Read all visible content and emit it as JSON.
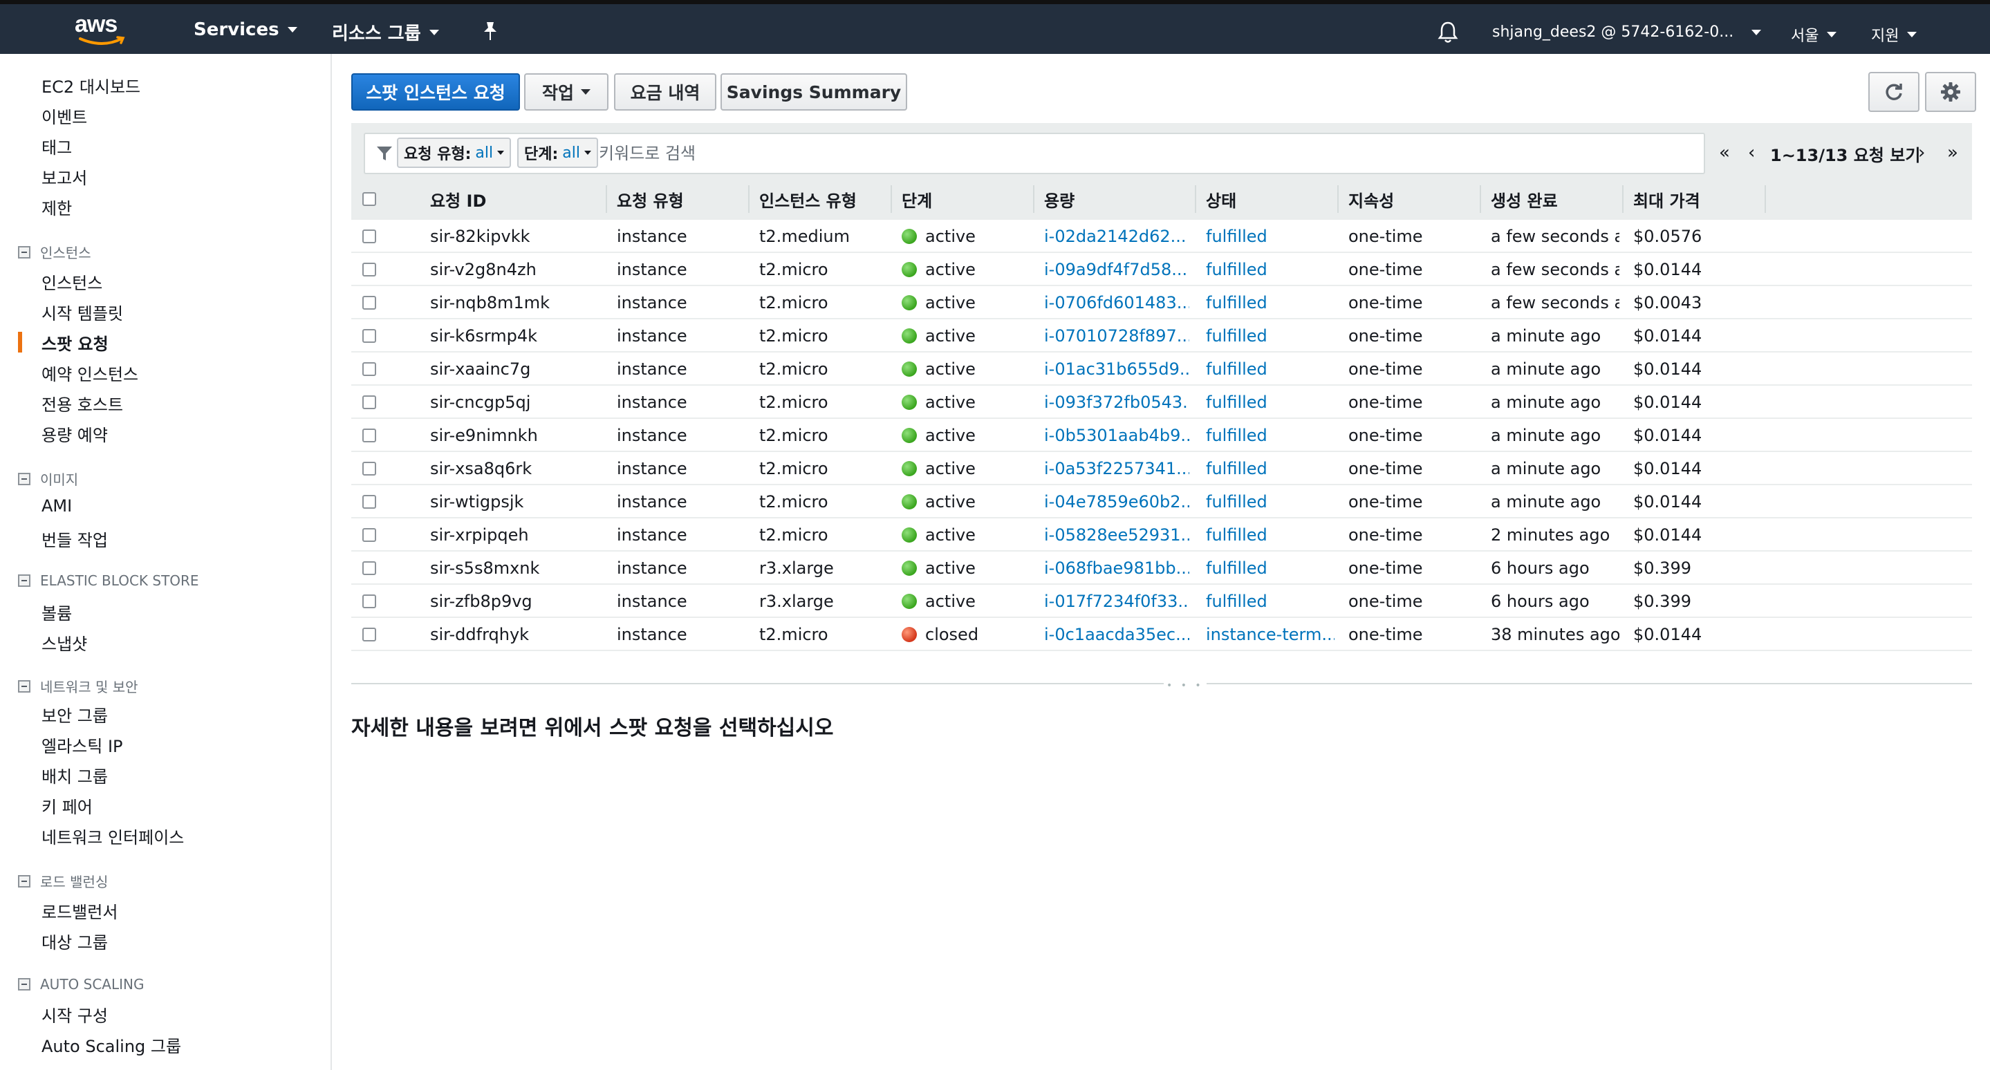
{
  "topnav": {
    "logo_text": "aws",
    "services_label": "Services",
    "resource_groups_label": "리소스 그룹",
    "account_label": "shjang_dees2 @ 5742-6162-0...",
    "region_label": "서울",
    "support_label": "지원"
  },
  "sidebar": {
    "top_items": [
      "EC2 대시보드",
      "이벤트",
      "태그",
      "보고서",
      "제한"
    ],
    "sections": [
      {
        "title": "인스턴스",
        "items": [
          "인스턴스",
          "시작 템플릿",
          "스팟 요청",
          "예약 인스턴스",
          "전용 호스트",
          "용량 예약"
        ]
      },
      {
        "title": "이미지",
        "items": [
          "AMI",
          "번들 작업"
        ]
      },
      {
        "title": "ELASTIC BLOCK STORE",
        "items": [
          "볼륨",
          "스냅샷"
        ]
      },
      {
        "title": "네트워크 및 보안",
        "items": [
          "보안 그룹",
          "엘라스틱 IP",
          "배치 그룹",
          "키 페어",
          "네트워크 인터페이스"
        ]
      },
      {
        "title": "로드 밸런싱",
        "items": [
          "로드밸런서",
          "대상 그룹"
        ]
      },
      {
        "title": "AUTO SCALING",
        "items": [
          "시작 구성",
          "Auto Scaling 그룹"
        ]
      }
    ],
    "active_item": "스팟 요청"
  },
  "toolbar": {
    "request_spot_label": "스팟 인스턴스 요청",
    "actions_label": "작업",
    "pricing_history_label": "요금 내역",
    "savings_summary_label": "Savings Summary"
  },
  "filter": {
    "request_type_label": "요청 유형:",
    "request_type_value": "all",
    "state_label": "단계:",
    "state_value": "all",
    "search_placeholder": "키워드로 검색",
    "pagination_text": "1~13/13 요청 보기"
  },
  "table": {
    "columns": [
      "요청 ID",
      "요청 유형",
      "인스턴스 유형",
      "단계",
      "용량",
      "상태",
      "지속성",
      "생성 완료",
      "최대 가격"
    ],
    "rows": [
      {
        "id": "sir-82kipvkk",
        "type": "instance",
        "instance_type": "t2.medium",
        "state": "active",
        "state_color": "green",
        "capacity": "i-02da2142d62...",
        "status": "fulfilled",
        "persistence": "one-time",
        "created": "a few seconds a...",
        "max_price": "$0.0576"
      },
      {
        "id": "sir-v2g8n4zh",
        "type": "instance",
        "instance_type": "t2.micro",
        "state": "active",
        "state_color": "green",
        "capacity": "i-09a9df4f7d58...",
        "status": "fulfilled",
        "persistence": "one-time",
        "created": "a few seconds a...",
        "max_price": "$0.0144"
      },
      {
        "id": "sir-nqb8m1mk",
        "type": "instance",
        "instance_type": "t2.micro",
        "state": "active",
        "state_color": "green",
        "capacity": "i-0706fd601483...",
        "status": "fulfilled",
        "persistence": "one-time",
        "created": "a few seconds a...",
        "max_price": "$0.0043"
      },
      {
        "id": "sir-k6srmp4k",
        "type": "instance",
        "instance_type": "t2.micro",
        "state": "active",
        "state_color": "green",
        "capacity": "i-07010728f897...",
        "status": "fulfilled",
        "persistence": "one-time",
        "created": "a minute ago",
        "max_price": "$0.0144"
      },
      {
        "id": "sir-xaainc7g",
        "type": "instance",
        "instance_type": "t2.micro",
        "state": "active",
        "state_color": "green",
        "capacity": "i-01ac31b655d9...",
        "status": "fulfilled",
        "persistence": "one-time",
        "created": "a minute ago",
        "max_price": "$0.0144"
      },
      {
        "id": "sir-cncgp5qj",
        "type": "instance",
        "instance_type": "t2.micro",
        "state": "active",
        "state_color": "green",
        "capacity": "i-093f372fb0543...",
        "status": "fulfilled",
        "persistence": "one-time",
        "created": "a minute ago",
        "max_price": "$0.0144"
      },
      {
        "id": "sir-e9nimnkh",
        "type": "instance",
        "instance_type": "t2.micro",
        "state": "active",
        "state_color": "green",
        "capacity": "i-0b5301aab4b9...",
        "status": "fulfilled",
        "persistence": "one-time",
        "created": "a minute ago",
        "max_price": "$0.0144"
      },
      {
        "id": "sir-xsa8q6rk",
        "type": "instance",
        "instance_type": "t2.micro",
        "state": "active",
        "state_color": "green",
        "capacity": "i-0a53f2257341...",
        "status": "fulfilled",
        "persistence": "one-time",
        "created": "a minute ago",
        "max_price": "$0.0144"
      },
      {
        "id": "sir-wtigpsjk",
        "type": "instance",
        "instance_type": "t2.micro",
        "state": "active",
        "state_color": "green",
        "capacity": "i-04e7859e60b2...",
        "status": "fulfilled",
        "persistence": "one-time",
        "created": "a minute ago",
        "max_price": "$0.0144"
      },
      {
        "id": "sir-xrpipqeh",
        "type": "instance",
        "instance_type": "t2.micro",
        "state": "active",
        "state_color": "green",
        "capacity": "i-05828ee52931...",
        "status": "fulfilled",
        "persistence": "one-time",
        "created": "2 minutes ago",
        "max_price": "$0.0144"
      },
      {
        "id": "sir-s5s8mxnk",
        "type": "instance",
        "instance_type": "r3.xlarge",
        "state": "active",
        "state_color": "green",
        "capacity": "i-068fbae981bb...",
        "status": "fulfilled",
        "persistence": "one-time",
        "created": "6 hours ago",
        "max_price": "$0.399"
      },
      {
        "id": "sir-zfb8p9vg",
        "type": "instance",
        "instance_type": "r3.xlarge",
        "state": "active",
        "state_color": "green",
        "capacity": "i-017f7234f0f33...",
        "status": "fulfilled",
        "persistence": "one-time",
        "created": "6 hours ago",
        "max_price": "$0.399"
      },
      {
        "id": "sir-ddfrqhyk",
        "type": "instance",
        "instance_type": "t2.micro",
        "state": "closed",
        "state_color": "red",
        "capacity": "i-0c1aacda35ec...",
        "status": "instance-term...",
        "persistence": "one-time",
        "created": "38 minutes ago",
        "max_price": "$0.0144"
      }
    ]
  },
  "detail": {
    "message": "자세한 내용을 보려면 위에서 스팟 요청을 선택하십시오"
  },
  "colors": {
    "nav_bg": "#232f3e",
    "primary_button": "#1166bb",
    "link": "#0073bb",
    "active_accent": "#ec7211"
  }
}
